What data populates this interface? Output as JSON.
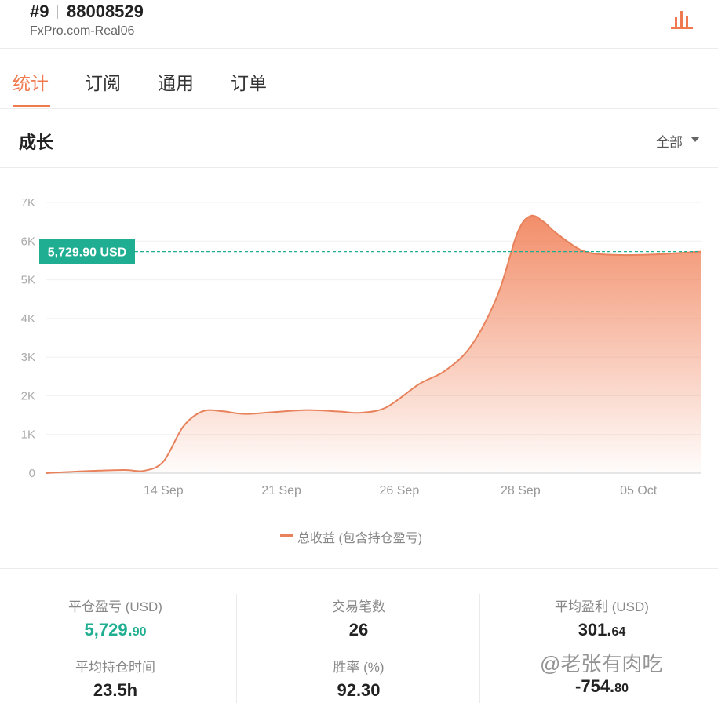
{
  "header": {
    "rank": "#9",
    "account": "88008529",
    "server": "FxPro.com-Real06",
    "icon": "bar-chart-icon",
    "accent": "#f07a4f"
  },
  "tabs": [
    {
      "label": "统计",
      "active": true
    },
    {
      "label": "订阅",
      "active": false
    },
    {
      "label": "通用",
      "active": false
    },
    {
      "label": "订单",
      "active": false
    }
  ],
  "section": {
    "title": "成长",
    "filter_value": "全部"
  },
  "chart_data": {
    "type": "area",
    "x_ticks": [
      "14 Sep",
      "21 Sep",
      "26 Sep",
      "28 Sep",
      "05 Oct"
    ],
    "y_ticks": [
      "0",
      "1K",
      "2K",
      "3K",
      "4K",
      "5K",
      "6K",
      "7K"
    ],
    "ylim": [
      0,
      7000
    ],
    "grid": true,
    "series": [
      {
        "name": "总收益 (包含持仓盈亏)",
        "color": "#e8825c",
        "x": [
          0,
          0.06,
          0.12,
          0.15,
          0.18,
          0.21,
          0.24,
          0.27,
          0.29,
          0.31,
          0.35,
          0.4,
          0.45,
          0.48,
          0.52,
          0.57,
          0.61,
          0.65,
          0.69,
          0.72,
          0.74,
          0.76,
          0.78,
          0.82,
          0.86,
          0.92,
          1.0
        ],
        "values": [
          0,
          50,
          80,
          60,
          300,
          1200,
          1600,
          1600,
          1550,
          1530,
          1580,
          1630,
          1590,
          1560,
          1700,
          2300,
          2650,
          3300,
          4600,
          6200,
          6650,
          6500,
          6200,
          5750,
          5650,
          5650,
          5729.9
        ]
      }
    ],
    "current_value_label": "5,729.90 USD",
    "current_value": 5729.9,
    "label_color": "#1fae91",
    "legend_position": "bottom"
  },
  "stats": [
    {
      "label": "平仓盈亏 (USD)",
      "int": "5,729.",
      "frac": "90",
      "color": "#1fae91"
    },
    {
      "label": "交易笔数",
      "int": "26",
      "frac": ""
    },
    {
      "label": "平均盈利 (USD)",
      "int": "301.",
      "frac": "64"
    },
    {
      "label": "平均持仓时间",
      "int": "23.5h",
      "frac": ""
    },
    {
      "label": "胜率 (%)",
      "int": "92.30",
      "frac": ""
    },
    {
      "label": "",
      "int": "-754.",
      "frac": "80"
    }
  ],
  "watermark": "@老张有肉吃"
}
